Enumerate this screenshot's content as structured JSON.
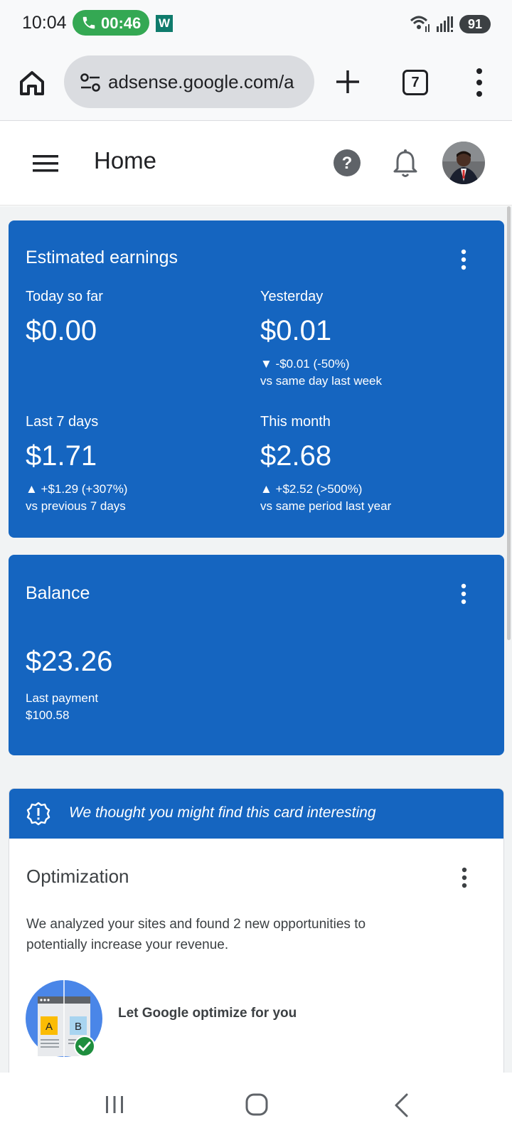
{
  "status_bar": {
    "time": "10:04",
    "call_timer": "00:46",
    "notification_app": "W",
    "battery": "91"
  },
  "browser": {
    "url": "adsense.google.com/a",
    "tab_count": "7"
  },
  "app_bar": {
    "title": "Home"
  },
  "estimated_earnings": {
    "title": "Estimated earnings",
    "today": {
      "label": "Today so far",
      "value": "$0.00"
    },
    "yesterday": {
      "label": "Yesterday",
      "value": "$0.01",
      "change": "▼ -$0.01 (-50%)",
      "comparison": "vs same day last week"
    },
    "last7": {
      "label": "Last 7 days",
      "value": "$1.71",
      "change": "▲ +$1.29 (+307%)",
      "comparison": "vs previous 7 days"
    },
    "month": {
      "label": "This month",
      "value": "$2.68",
      "change": "▲ +$2.52 (>500%)",
      "comparison": "vs same period last year"
    }
  },
  "balance": {
    "title": "Balance",
    "value": "$23.26",
    "last_payment_label": "Last payment",
    "last_payment_value": "$100.58"
  },
  "optimization": {
    "banner_text": "We thought you might find this card interesting",
    "title": "Optimization",
    "description": "We analyzed your sites and found 2 new opportunities to potentially increase your revenue.",
    "cta": "Let Google optimize for you",
    "illustration_labels": [
      "A",
      "B"
    ]
  },
  "colors": {
    "card_blue": "#1565c0",
    "call_green": "#34a853"
  },
  "icons": [
    "phone-icon",
    "wifi-icon",
    "signal-icon",
    "home-icon",
    "tune-icon",
    "plus-icon",
    "more-vert-icon",
    "menu-icon",
    "help-icon",
    "bell-icon",
    "info-alert-icon",
    "recents-icon",
    "home-circle-icon",
    "back-icon"
  ]
}
